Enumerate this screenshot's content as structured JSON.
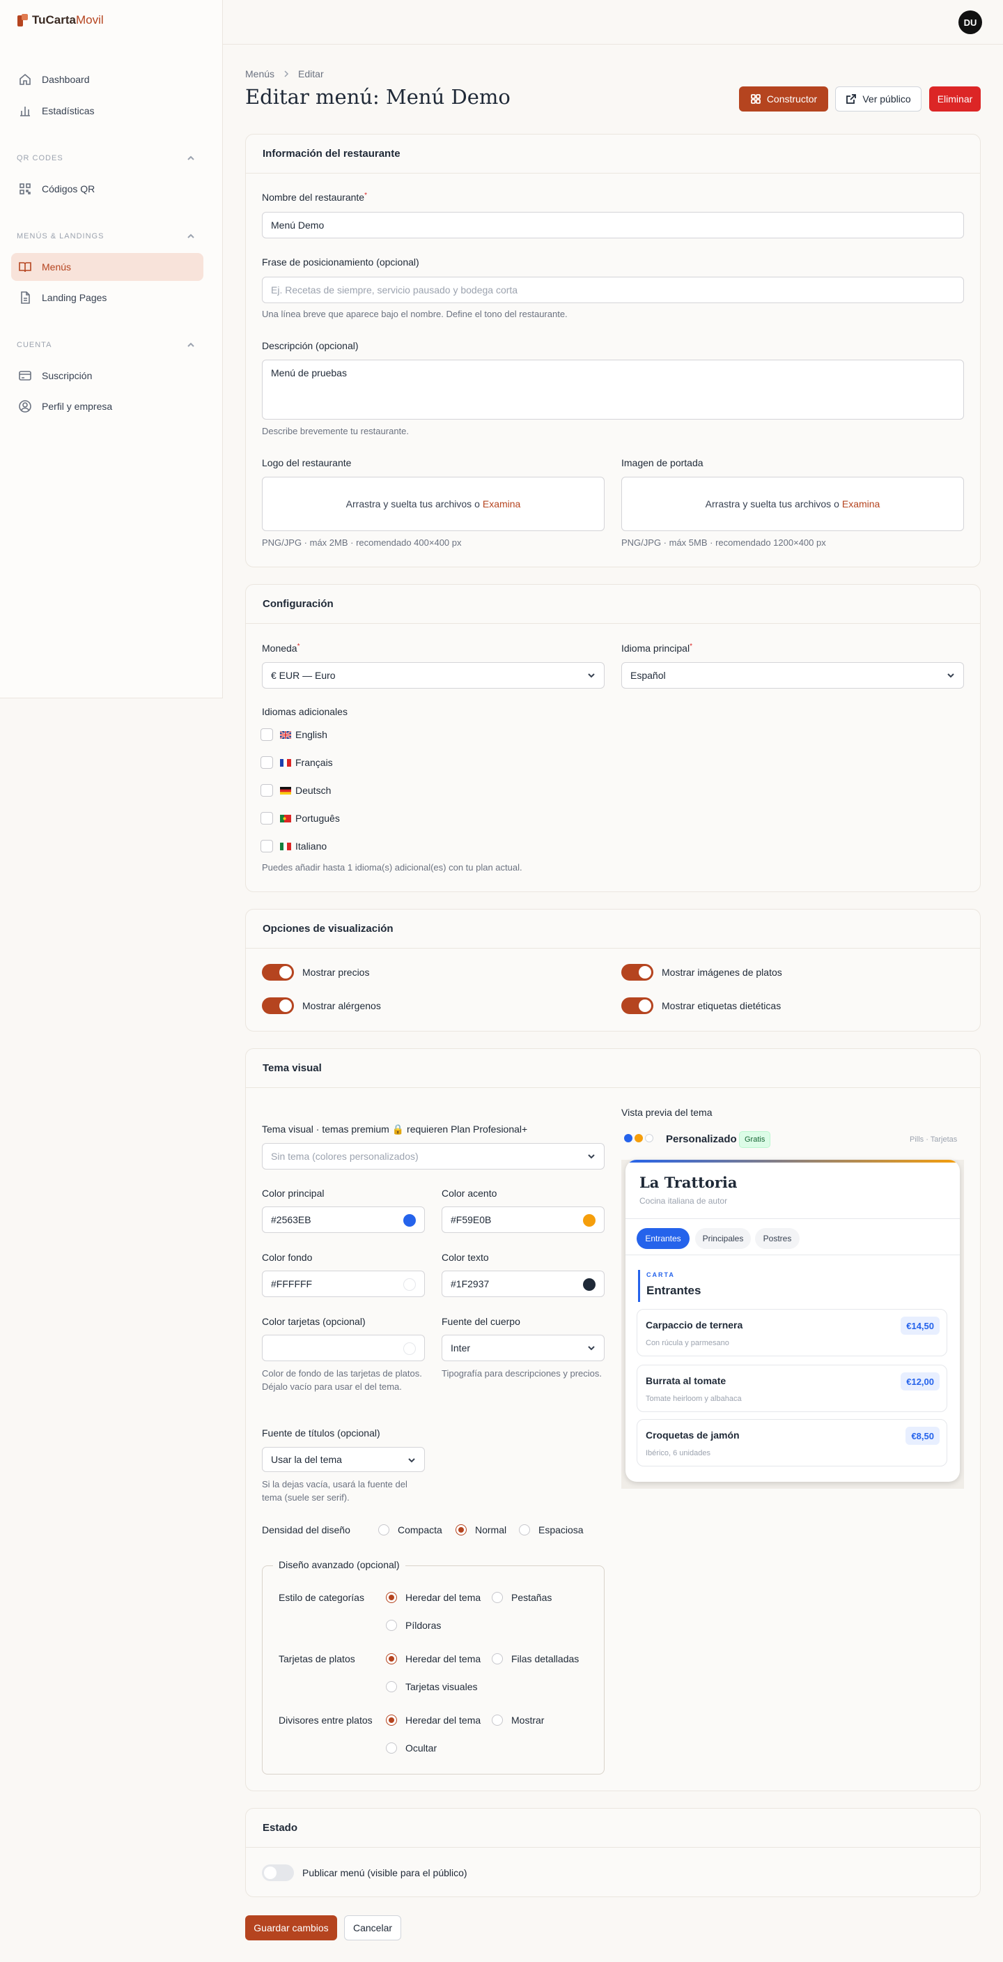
{
  "app": {
    "name_part1": "TuCarta",
    "name_part2": "Movil",
    "avatar": "DU"
  },
  "sidebar": {
    "top_items": [
      {
        "label": "Dashboard"
      },
      {
        "label": "Estadísticas"
      }
    ],
    "sections": [
      {
        "title": "QR CODES",
        "items": [
          {
            "label": "Códigos QR"
          }
        ]
      },
      {
        "title": "MENÚS & LANDINGS",
        "items": [
          {
            "label": "Menús"
          },
          {
            "label": "Landing Pages"
          }
        ]
      },
      {
        "title": "CUENTA",
        "items": [
          {
            "label": "Suscripción"
          },
          {
            "label": "Perfil y empresa"
          }
        ]
      }
    ]
  },
  "breadcrumb": {
    "root": "Menús",
    "current": "Editar"
  },
  "page": {
    "title": "Editar menú: Menú Demo"
  },
  "actions": {
    "builder": "Constructor",
    "public": "Ver público",
    "delete": "Eliminar"
  },
  "info": {
    "title": "Información del restaurante",
    "name_label": "Nombre del restaurante",
    "name_value": "Menú Demo",
    "tagline_label": "Frase de posicionamiento (opcional)",
    "tagline_placeholder": "Ej. Recetas de siempre, servicio pausado y bodega corta",
    "tagline_help": "Una línea breve que aparece bajo el nombre. Define el tono del restaurante.",
    "desc_label": "Descripción (opcional)",
    "desc_value": "Menú de pruebas",
    "desc_help": "Describe brevemente tu restaurante.",
    "logo_label": "Logo del restaurante",
    "cover_label": "Imagen de portada",
    "drop_text": "Arrastra y suelta tus archivos o",
    "drop_link": "Examina",
    "logo_help": "PNG/JPG · máx 2MB · recomendado 400×400 px",
    "cover_help": "PNG/JPG · máx 5MB · recomendado 1200×400 px"
  },
  "config": {
    "title": "Configuración",
    "currency_label": "Moneda",
    "currency_value": "€ EUR — Euro",
    "lang_label": "Idioma principal",
    "lang_value": "Español",
    "extra_label": "Idiomas adicionales",
    "languages": [
      {
        "label": "English"
      },
      {
        "label": "Français"
      },
      {
        "label": "Deutsch"
      },
      {
        "label": "Português"
      },
      {
        "label": "Italiano"
      }
    ],
    "help": "Puedes añadir hasta 1 idioma(s) adicional(es) con tu plan actual."
  },
  "display": {
    "title": "Opciones de visualización",
    "opts": [
      {
        "label": "Mostrar precios",
        "on": true
      },
      {
        "label": "Mostrar imágenes de platos",
        "on": true
      },
      {
        "label": "Mostrar alérgenos",
        "on": true
      },
      {
        "label": "Mostrar etiquetas dietéticas",
        "on": true
      }
    ]
  },
  "theme": {
    "title": "Tema visual",
    "select_label": "Tema visual · temas premium 🔒 requieren Plan Profesional+",
    "select_placeholder": "Sin tema (colores personalizados)",
    "primary_label": "Color principal",
    "primary_value": "#2563EB",
    "accent_label": "Color acento",
    "accent_value": "#F59E0B",
    "bg_label": "Color fondo",
    "bg_value": "#FFFFFF",
    "text_label": "Color texto",
    "text_value": "#1F2937",
    "cards_label": "Color tarjetas (opcional)",
    "cards_help": "Color de fondo de las tarjetas de platos. Déjalo vacío para usar el del tema.",
    "body_font_label": "Fuente del cuerpo",
    "body_font_value": "Inter",
    "body_font_help": "Tipografía para descripciones y precios.",
    "title_font_label": "Fuente de títulos (opcional)",
    "title_font_value": "Usar la del tema",
    "title_font_help": "Si la dejas vacía, usará la fuente del tema (suele ser serif).",
    "density_label": "Densidad del diseño",
    "density": [
      {
        "label": "Compacta",
        "on": false
      },
      {
        "label": "Normal",
        "on": true
      },
      {
        "label": "Espaciosa",
        "on": false
      }
    ],
    "advanced_legend": "Diseño avanzado (opcional)",
    "cat_label": "Estilo de categorías",
    "cat_opts": [
      {
        "label": "Heredar del tema",
        "on": true
      },
      {
        "label": "Pestañas",
        "on": false
      },
      {
        "label": "Píldoras",
        "on": false
      }
    ],
    "dish_label": "Tarjetas de platos",
    "dish_opts": [
      {
        "label": "Heredar del tema",
        "on": true
      },
      {
        "label": "Filas detalladas",
        "on": false
      },
      {
        "label": "Tarjetas visuales",
        "on": false
      }
    ],
    "div_label": "Divisores entre platos",
    "div_opts": [
      {
        "label": "Heredar del tema",
        "on": true
      },
      {
        "label": "Mostrar",
        "on": false
      },
      {
        "label": "Ocultar",
        "on": false
      }
    ]
  },
  "preview": {
    "title": "Vista previa del tema",
    "theme_name": "Personalizado",
    "badge": "Gratis",
    "mode": "Pills · Tarjetas",
    "restaurant": "La Trattoria",
    "subtitle": "Cocina italiana de autor",
    "tabs": [
      "Entrantes",
      "Principales",
      "Postres"
    ],
    "kicker": "CARTA",
    "section": "Entrantes",
    "dishes": [
      {
        "name": "Carpaccio de ternera",
        "desc": "Con rúcula y parmesano",
        "price": "€14,50"
      },
      {
        "name": "Burrata al tomate",
        "desc": "Tomate heirloom y albahaca",
        "price": "€12,00"
      },
      {
        "name": "Croquetas de jamón",
        "desc": "Ibérico, 6 unidades",
        "price": "€8,50"
      }
    ],
    "colors": {
      "primary": "#2563EB",
      "accent": "#F59E0B",
      "text": "#1F2937"
    }
  },
  "status": {
    "title": "Estado",
    "publish_label": "Publicar menú (visible para el público)",
    "published": false
  },
  "footer": {
    "save": "Guardar cambios",
    "cancel": "Cancelar"
  }
}
